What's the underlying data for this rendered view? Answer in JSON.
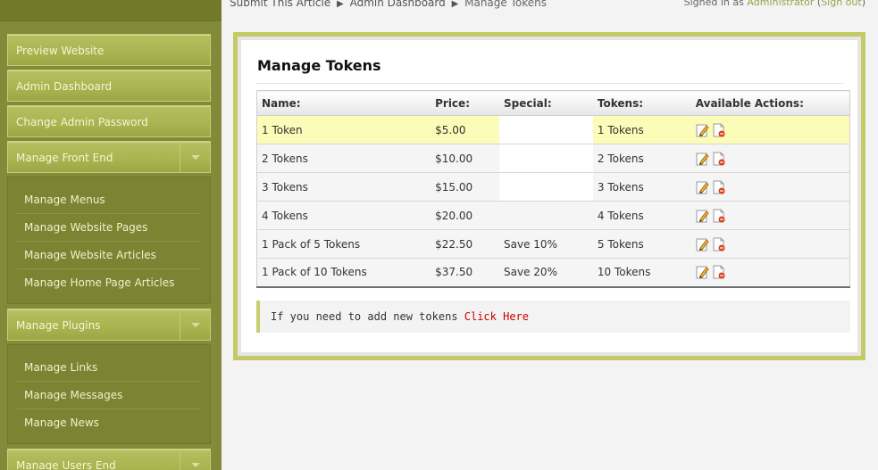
{
  "breadcrumb": {
    "items": [
      "Submit This Article",
      "Admin Dashboard",
      "Manage Tokens"
    ],
    "separator": "▶"
  },
  "signin": {
    "prefix": "Signed in as",
    "user": "Administrator",
    "signout": "Sign out",
    "open_paren": "(",
    "close_paren": ")"
  },
  "sidebar": {
    "buttons": [
      {
        "label": "Preview Website"
      },
      {
        "label": "Admin Dashboard"
      },
      {
        "label": "Change Admin Password"
      },
      {
        "label": "Manage Front End"
      },
      {
        "label": "Manage Plugins"
      },
      {
        "label": "Manage Users End"
      }
    ],
    "front_end_items": [
      "Manage Menus",
      "Manage Website Pages",
      "Manage Website Articles",
      "Manage Home Page Articles"
    ],
    "plugin_items": [
      "Manage Links",
      "Manage Messages",
      "Manage News"
    ]
  },
  "main": {
    "title": "Manage Tokens",
    "table": {
      "headers": [
        "Name:",
        "Price:",
        "Special:",
        "Tokens:",
        "Available Actions:"
      ],
      "rows": [
        {
          "name": "1 Token",
          "price": "$5.00",
          "special": "",
          "tokens": "1 Tokens"
        },
        {
          "name": "2 Tokens",
          "price": "$10.00",
          "special": "",
          "tokens": "2 Tokens"
        },
        {
          "name": "3 Tokens",
          "price": "$15.00",
          "special": "",
          "tokens": "3 Tokens"
        },
        {
          "name": "4 Tokens",
          "price": "$20.00",
          "special": "",
          "tokens": "4 Tokens"
        },
        {
          "name": "1 Pack of 5 Tokens",
          "price": "$22.50",
          "special": "Save 10%",
          "tokens": "5 Tokens"
        },
        {
          "name": "1 Pack of 10 Tokens",
          "price": "$37.50",
          "special": "Save 20%",
          "tokens": "10 Tokens"
        }
      ]
    },
    "notice": {
      "text": "If you need to add new tokens",
      "link": "Click Here"
    }
  },
  "icons": {
    "edit": "pencil-edit-icon",
    "delete": "delete-document-icon"
  },
  "colors": {
    "sidebar": "#838a3a",
    "button": "#a9b34f",
    "panel_border": "#c3ca66",
    "highlight_row": "#fbfcb8",
    "link_red": "#cc0000",
    "accent_link": "#9aa24a"
  }
}
